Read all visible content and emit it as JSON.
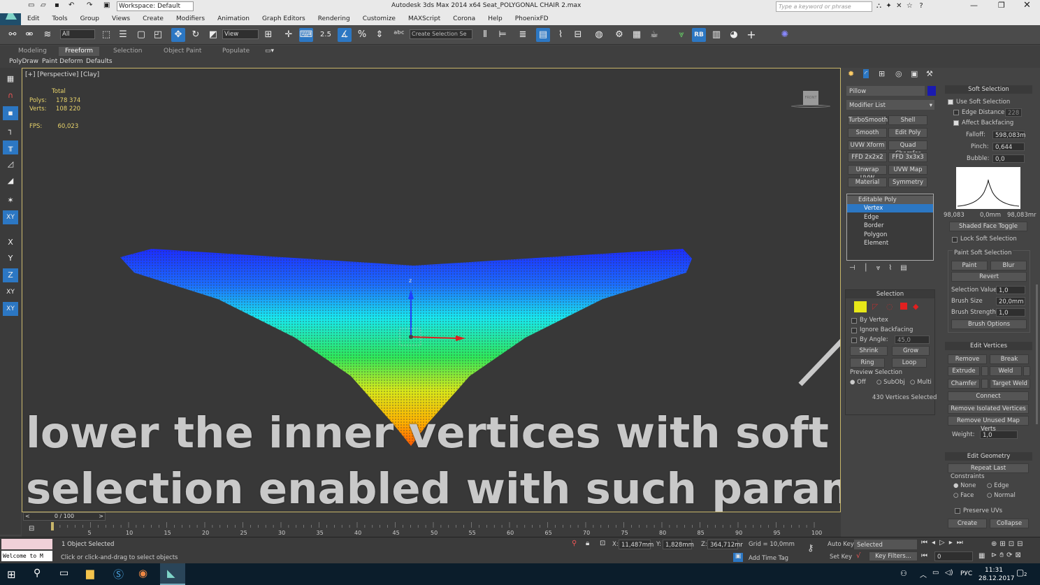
{
  "window": {
    "title": "Autodesk 3ds Max  2014 x64      Seat_POLYGONAL CHAIR 2.max",
    "workspace": "Workspace: Default",
    "search_placeholder": "Type a keyword or phrase"
  },
  "menu": [
    "Edit",
    "Tools",
    "Group",
    "Views",
    "Create",
    "Modifiers",
    "Animation",
    "Graph Editors",
    "Rendering",
    "Customize",
    "MAXScript",
    "Corona",
    "Help",
    "PhoenixFD"
  ],
  "toolbar": {
    "filter": "All",
    "refcoord": "View",
    "snap_angle": "2.5",
    "selection_set": "Create Selection Se"
  },
  "ribbon": {
    "tabs": [
      "Modeling",
      "Freeform",
      "Selection",
      "Object Paint",
      "Populate"
    ],
    "subtabs": [
      "PolyDraw",
      "Paint Deform",
      "Defaults"
    ]
  },
  "viewport": {
    "label": "[+] [Perspective] [Clay]",
    "stats_total": "Total",
    "polys_label": "Polys:",
    "polys_value": "178 374",
    "verts_label": "Verts:",
    "verts_value": "108 220",
    "fps_label": "FPS:",
    "fps_value": "60,023",
    "overlay_line1": "lower the inner vertices with soft",
    "overlay_line2": "selection enabled with such parameters",
    "viewcube_label": "FRONT",
    "axis_z": "z"
  },
  "left_toolbar": [
    "X",
    "Y",
    "Z",
    "XY",
    "XY"
  ],
  "command_panel": {
    "object_name": "Pillow",
    "object_color": "#1a1ab0",
    "modifier_list": "Modifier List",
    "modifier_buttons": [
      "TurboSmooth",
      "Shell",
      "Smooth",
      "Edit Poly",
      "UVW Xform",
      "Quad Chamfer",
      "FFD 2x2x2",
      "FFD 3x3x3",
      "Unwrap UVW",
      "UVW Map",
      "Material",
      "Symmetry"
    ],
    "stack": [
      "Editable Poly",
      "Vertex",
      "Edge",
      "Border",
      "Polygon",
      "Element"
    ],
    "selection": {
      "header": "Selection",
      "by_vertex": "By Vertex",
      "ignore_backfacing": "Ignore Backfacing",
      "by_angle": "By Angle:",
      "by_angle_value": "45,0",
      "shrink": "Shrink",
      "grow": "Grow",
      "ring": "Ring",
      "loop": "Loop",
      "preview_selection": "Preview Selection",
      "preview_options": [
        "Off",
        "SubObj",
        "Multi"
      ],
      "status": "430 Vertices Selected"
    }
  },
  "soft_selection": {
    "header": "Soft Selection",
    "use_soft_selection": "Use Soft Selection",
    "edge_distance": "Edge Distance:",
    "edge_distance_value": "228",
    "affect_backfacing": "Affect Backfacing",
    "falloff_label": "Falloff:",
    "falloff_value": "598,083m",
    "pinch_label": "Pinch:",
    "pinch_value": "0,644",
    "bubble_label": "Bubble:",
    "bubble_value": "0,0",
    "curve_left": "98,083",
    "curve_mid": "0,0mm",
    "curve_right": "98,083mr",
    "shaded_face_toggle": "Shaded Face Toggle",
    "lock_soft_selection": "Lock Soft Selection",
    "paint_soft_selection": "Paint Soft Selection",
    "paint": "Paint",
    "blur": "Blur",
    "revert": "Revert",
    "selection_value_label": "Selection Value",
    "selection_value": "1,0",
    "brush_size_label": "Brush Size",
    "brush_size": "20,0mm",
    "brush_strength_label": "Brush Strength",
    "brush_strength": "1,0",
    "brush_options": "Brush Options"
  },
  "edit_vertices": {
    "header": "Edit Vertices",
    "remove": "Remove",
    "break": "Break",
    "extrude": "Extrude",
    "weld": "Weld",
    "chamfer": "Chamfer",
    "target_weld": "Target Weld",
    "connect": "Connect",
    "remove_isolated": "Remove Isolated Vertices",
    "remove_unused": "Remove Unused Map Verts",
    "weight_label": "Weight:",
    "weight_value": "1,0"
  },
  "edit_geometry": {
    "header": "Edit Geometry",
    "repeat_last": "Repeat Last",
    "constraints": "Constraints",
    "options": [
      "None",
      "Edge",
      "Face",
      "Normal"
    ],
    "preserve_uvs": "Preserve UVs",
    "create": "Create",
    "collapse": "Collapse"
  },
  "timeline": {
    "frame": "0 / 100",
    "ticks": [
      "5",
      "10",
      "15",
      "20",
      "25",
      "30",
      "35",
      "40",
      "45",
      "50",
      "55",
      "60",
      "65",
      "70",
      "75",
      "80",
      "85",
      "90",
      "95",
      "100"
    ]
  },
  "status": {
    "maxscript": "Welcome to M",
    "selected": "1 Object Selected",
    "prompt": "Click or click-and-drag to select objects",
    "x_value": "11,487mm",
    "y_value": "1,828mm",
    "z_value": "364,712mr",
    "grid": "Grid = 10,0mm",
    "add_time_tag": "Add Time Tag",
    "auto_key": "Auto Key",
    "set_key": "Set Key",
    "key_mode": "Selected",
    "key_filters": "Key Filters...",
    "current_frame": "0"
  },
  "taskbar": {
    "lang": "РУС",
    "time": "11:31",
    "date": "28.12.2017",
    "notifications": "2"
  }
}
